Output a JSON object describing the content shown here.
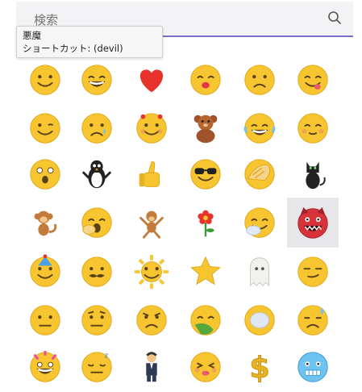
{
  "search": {
    "placeholder": "検索",
    "icon": "search-icon"
  },
  "tooltip": {
    "name": "悪魔",
    "shortcut": "ショートカット: (devil)"
  },
  "colors": {
    "accent": "#7a6fc7",
    "emoji_yellow": "#f6c530",
    "selected_bg": "#e7e7e9"
  },
  "emoji_grid": {
    "selected": "devil",
    "rows": [
      [
        "smile",
        "laugh",
        "heart",
        "kiss",
        "sad",
        "tongue-out"
      ],
      [
        "wink",
        "crying",
        "blush",
        "teddy-bear",
        "laugh-tears",
        "blushing"
      ],
      [
        "surprised",
        "penguin",
        "thumbs-up",
        "cool-sunglasses",
        "face-palm",
        "cat"
      ],
      [
        "monkey",
        "yawn",
        "dancing-monkey",
        "flower",
        "yawning-hand",
        "devil"
      ],
      [
        "party",
        "mustache",
        "sun",
        "star",
        "ghost",
        "smirk"
      ],
      [
        "neutral",
        "raised-eyebrow",
        "angry",
        "sick",
        "tired-hand",
        "sweat"
      ],
      [
        "crazy",
        "sleepy",
        "businessman",
        "drunk",
        "dollar",
        "frozen"
      ]
    ]
  }
}
